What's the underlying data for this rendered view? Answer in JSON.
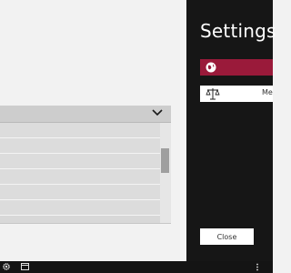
{
  "settings_panel": {
    "title": "Settings",
    "items": [
      {
        "icon": "globe-icon",
        "label": ""
      },
      {
        "icon": "scale-icon",
        "label": "Mea"
      }
    ],
    "close_label": "Close"
  },
  "dropdown": {
    "selected_value": "",
    "icon": "chevron-down-icon"
  },
  "list": {
    "rows": [
      "",
      "",
      "",
      "",
      "",
      ""
    ]
  },
  "taskbar": {
    "icons": [
      "gear-icon",
      "window-icon",
      "overflow-dots-icon"
    ]
  },
  "colors": {
    "accent": "#9a1a3a",
    "panel_bg": "#161616",
    "app_bg": "#f2f2f2"
  }
}
